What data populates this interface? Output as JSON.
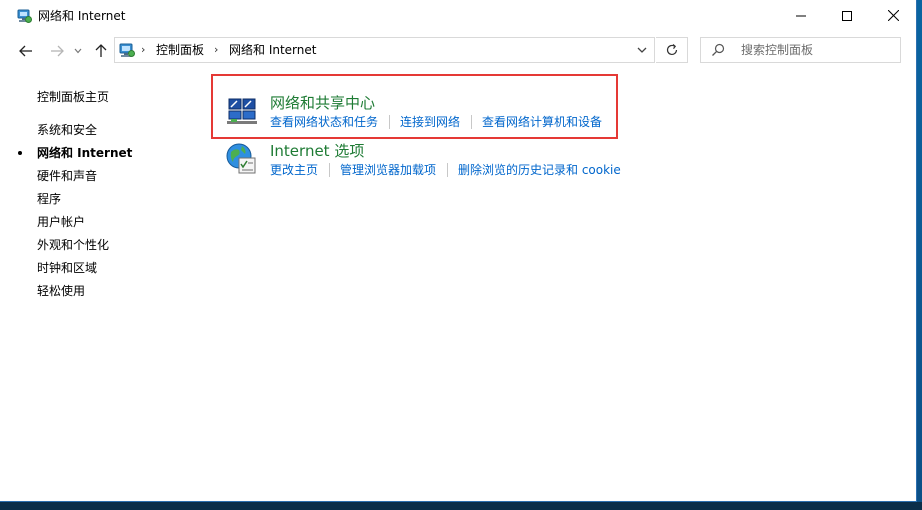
{
  "window": {
    "title": "网络和 Internet",
    "icon": "network-internet-icon"
  },
  "titlebar_buttons": {
    "minimize": "minimize-icon",
    "maximize": "maximize-icon",
    "close": "close-icon"
  },
  "navbar": {
    "back": "back-arrow-icon",
    "forward": "forward-arrow-icon",
    "recent": "chevron-down-icon",
    "up": "up-arrow-icon",
    "breadcrumb": [
      "控制面板",
      "网络和 Internet"
    ],
    "refresh": "refresh-icon",
    "search_placeholder": "搜索控制面板"
  },
  "sidebar": {
    "home": "控制面板主页",
    "items": [
      {
        "label": "系统和安全",
        "active": false
      },
      {
        "label": "网络和 Internet",
        "active": true
      },
      {
        "label": "硬件和声音",
        "active": false
      },
      {
        "label": "程序",
        "active": false
      },
      {
        "label": "用户帐户",
        "active": false
      },
      {
        "label": "外观和个性化",
        "active": false
      },
      {
        "label": "时钟和区域",
        "active": false
      },
      {
        "label": "轻松使用",
        "active": false
      }
    ]
  },
  "categories": [
    {
      "title": "网络和共享中心",
      "icon": "network-sharing-center-icon",
      "highlighted": true,
      "links": [
        "查看网络状态和任务",
        "连接到网络",
        "查看网络计算机和设备"
      ]
    },
    {
      "title": "Internet 选项",
      "icon": "internet-options-icon",
      "highlighted": false,
      "links": [
        "更改主页",
        "管理浏览器加载项",
        "删除浏览的历史记录和 cookie"
      ]
    }
  ],
  "colors": {
    "category_title": "#1e7b34",
    "link": "#0066cc",
    "highlight_border": "#e53935"
  }
}
